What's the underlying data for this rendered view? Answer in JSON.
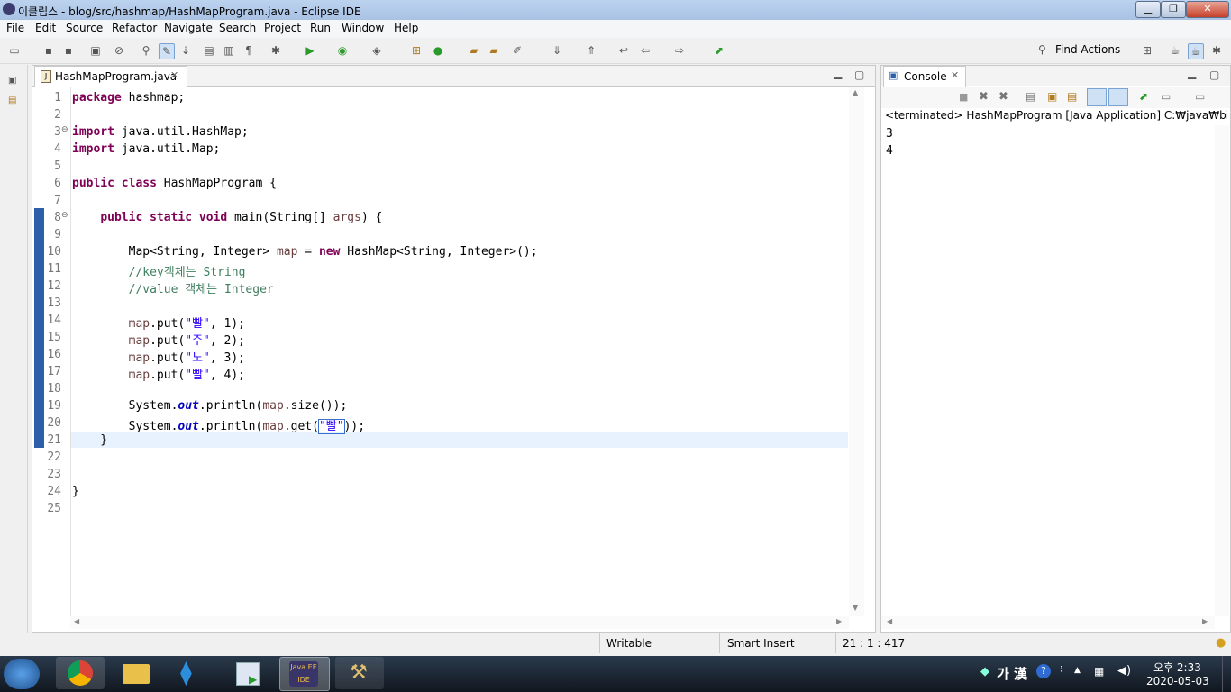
{
  "window": {
    "title": "이클립스 - blog/src/hashmap/HashMapProgram.java - Eclipse IDE"
  },
  "menu": [
    "File",
    "Edit",
    "Source",
    "Refactor",
    "Navigate",
    "Search",
    "Project",
    "Run",
    "Window",
    "Help"
  ],
  "toolbar": {
    "find_actions": "Find Actions"
  },
  "editor": {
    "tab_label": "HashMapProgram.java",
    "line_numbers": [
      "1",
      "2",
      "3",
      "4",
      "5",
      "6",
      "7",
      "8",
      "9",
      "10",
      "11",
      "12",
      "13",
      "14",
      "15",
      "16",
      "17",
      "18",
      "19",
      "20",
      "21",
      "22",
      "23",
      "24",
      "25"
    ]
  },
  "console": {
    "tab_label": "Console",
    "header": "<terminated> HashMapProgram [Java Application] C:₩java₩bin₩javaw",
    "output": [
      "3",
      "4"
    ]
  },
  "status": {
    "writable": "Writable",
    "insert_mode": "Smart Insert",
    "position": "21 : 1 : 417"
  },
  "taskbar": {
    "ime": "가 漢",
    "time": "오후 2:33",
    "date": "2020-05-03",
    "javaee_label": "Java EE IDE"
  }
}
